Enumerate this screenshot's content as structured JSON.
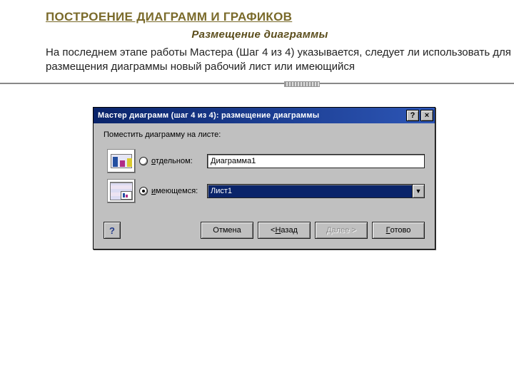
{
  "page": {
    "heading": "ПОСТРОЕНИЕ  ДИАГРАММ И ГРАФИКОВ",
    "subheading": "Размещение диаграммы",
    "body": "На последнем этапе работы Мастера (Шаг 4 из 4) указывается, следует ли использовать для размещения диаграммы новый рабочий лист или  имеющийся"
  },
  "dialog": {
    "title": "Мастер диаграмм (шаг 4 из 4): размещение диаграммы",
    "help_glyph": "?",
    "close_glyph": "×",
    "group_label": "Поместить диаграмму на листе:",
    "option_separate": {
      "prefix": "о",
      "rest": "тдельном:",
      "value": "Диаграмма1"
    },
    "option_existing": {
      "prefix": "и",
      "rest": "меющемся:",
      "value": "Лист1"
    },
    "help_btn": "?",
    "buttons": {
      "cancel": "Отмена",
      "back_prefix": "< ",
      "back_u": "Н",
      "back_rest": "азад",
      "next_prefix": "Д",
      "next_rest": "алее >",
      "finish_u": "Г",
      "finish_rest": "отово"
    },
    "combo_arrow": "▼"
  }
}
